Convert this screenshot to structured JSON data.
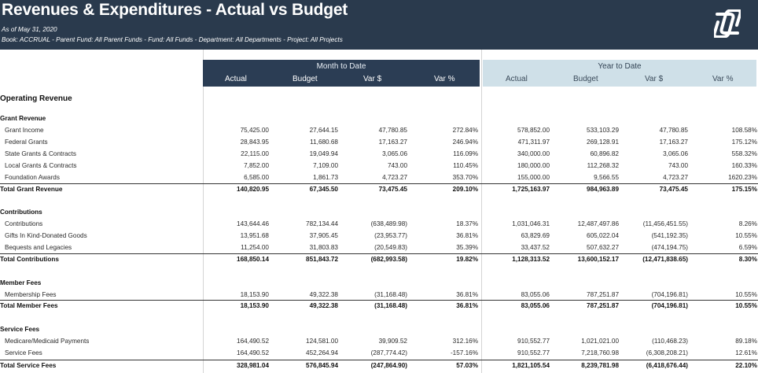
{
  "report": {
    "title": "Revenues & Expenditures - Actual vs Budget",
    "as_of": "As of May 31, 2020",
    "filters": "Book: ACCRUAL - Parent Fund: All Parent Funds - Fund: All Funds - Department: All Departments - Project: All Projects"
  },
  "logo_icon": "brand-logo-icon",
  "colors": {
    "header_bg": "#2a3a4d",
    "mtd_band": "#2b3d54",
    "ytd_band": "#cfe0e8"
  },
  "bands": {
    "mtd": "Month to Date",
    "ytd": "Year to Date"
  },
  "columns": [
    "Actual",
    "Budget",
    "Var $",
    "Var %",
    "Actual",
    "Budget",
    "Var $",
    "Var %"
  ],
  "section_title": "Operating Revenue",
  "rows": [
    {
      "type": "group",
      "label": "Grant Revenue"
    },
    {
      "type": "item",
      "label": "Grant Income",
      "values": [
        "75,425.00",
        "27,644.15",
        "47,780.85",
        "272.84%",
        "578,852.00",
        "533,103.29",
        "47,780.85",
        "108.58%"
      ]
    },
    {
      "type": "item",
      "label": "Federal Grants",
      "values": [
        "28,843.95",
        "11,680.68",
        "17,163.27",
        "246.94%",
        "471,311.97",
        "269,128.91",
        "17,163.27",
        "175.12%"
      ]
    },
    {
      "type": "item",
      "label": "State Grants & Contracts",
      "values": [
        "22,115.00",
        "19,049.94",
        "3,065.06",
        "116.09%",
        "340,000.00",
        "60,896.82",
        "3,065.06",
        "558.32%"
      ]
    },
    {
      "type": "item",
      "label": "Local Grants & Contracts",
      "values": [
        "7,852.00",
        "7,109.00",
        "743.00",
        "110.45%",
        "180,000.00",
        "112,268.32",
        "743.00",
        "160.33%"
      ]
    },
    {
      "type": "item",
      "label": "Foundation Awards",
      "values": [
        "6,585.00",
        "1,861.73",
        "4,723.27",
        "353.70%",
        "155,000.00",
        "9,566.55",
        "4,723.27",
        "1620.23%"
      ]
    },
    {
      "type": "total",
      "label": "Total Grant Revenue",
      "values": [
        "140,820.95",
        "67,345.50",
        "73,475.45",
        "209.10%",
        "1,725,163.97",
        "984,963.89",
        "73,475.45",
        "175.15%"
      ]
    },
    {
      "type": "group",
      "label": "Contributions"
    },
    {
      "type": "item",
      "label": "Contributions",
      "values": [
        "143,644.46",
        "782,134.44",
        "(638,489.98)",
        "18.37%",
        "1,031,046.31",
        "12,487,497.86",
        "(11,456,451.55)",
        "8.26%"
      ]
    },
    {
      "type": "item",
      "label": "Gifts In Kind-Donated Goods",
      "values": [
        "13,951.68",
        "37,905.45",
        "(23,953.77)",
        "36.81%",
        "63,829.69",
        "605,022.04",
        "(541,192.35)",
        "10.55%"
      ]
    },
    {
      "type": "item",
      "label": "Bequests and Legacies",
      "values": [
        "11,254.00",
        "31,803.83",
        "(20,549.83)",
        "35.39%",
        "33,437.52",
        "507,632.27",
        "(474,194.75)",
        "6.59%"
      ]
    },
    {
      "type": "total",
      "label": "Total Contributions",
      "values": [
        "168,850.14",
        "851,843.72",
        "(682,993.58)",
        "19.82%",
        "1,128,313.52",
        "13,600,152.17",
        "(12,471,838.65)",
        "8.30%"
      ]
    },
    {
      "type": "group",
      "label": "Member Fees"
    },
    {
      "type": "item",
      "label": "Membership Fees",
      "values": [
        "18,153.90",
        "49,322.38",
        "(31,168.48)",
        "36.81%",
        "83,055.06",
        "787,251.87",
        "(704,196.81)",
        "10.55%"
      ]
    },
    {
      "type": "total",
      "label": "Total Member Fees",
      "values": [
        "18,153.90",
        "49,322.38",
        "(31,168.48)",
        "36.81%",
        "83,055.06",
        "787,251.87",
        "(704,196.81)",
        "10.55%"
      ]
    },
    {
      "type": "group",
      "label": "Service Fees"
    },
    {
      "type": "item",
      "label": "Medicare/Medicaid Payments",
      "values": [
        "164,490.52",
        "124,581.00",
        "39,909.52",
        "312.16%",
        "910,552.77",
        "1,021,021.00",
        "(110,468.23)",
        "89.18%"
      ]
    },
    {
      "type": "item",
      "label": "Service Fees",
      "values": [
        "164,490.52",
        "452,264.94",
        "(287,774.42)",
        "-157.16%",
        "910,552.77",
        "7,218,760.98",
        "(6,308,208.21)",
        "12.61%"
      ]
    },
    {
      "type": "total",
      "label": "Total Service Fees",
      "values": [
        "328,981.04",
        "576,845.94",
        "(247,864.90)",
        "57.03%",
        "1,821,105.54",
        "8,239,781.98",
        "(6,418,676.44)",
        "22.10%"
      ]
    }
  ]
}
